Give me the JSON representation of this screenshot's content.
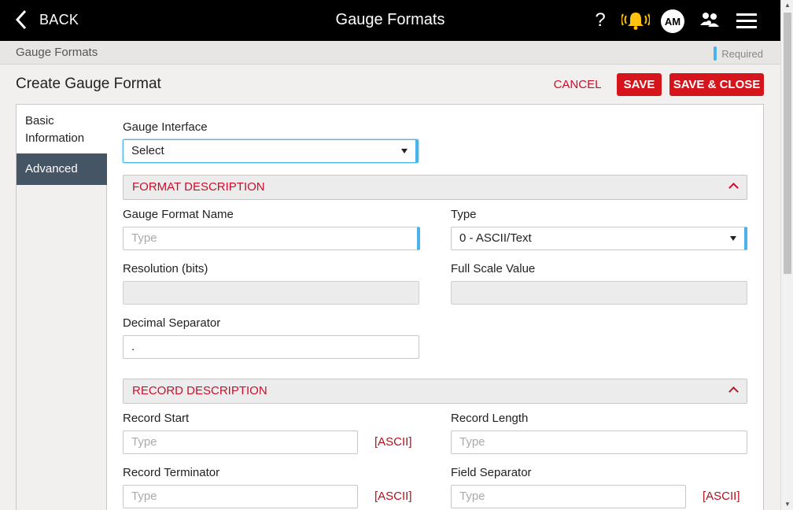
{
  "topbar": {
    "back_label": "BACK",
    "title": "Gauge Formats",
    "help_label": "?",
    "avatar_initials": "AM"
  },
  "breadcrumb": {
    "text": "Gauge Formats",
    "required_label": "Required"
  },
  "page": {
    "heading": "Create Gauge Format",
    "cancel_label": "CANCEL",
    "save_label": "SAVE",
    "save_close_label": "SAVE & CLOSE"
  },
  "sidebar": {
    "items": [
      {
        "label_line1": "Basic",
        "label_line2": "Information"
      },
      {
        "label": "Advanced"
      }
    ]
  },
  "form": {
    "gauge_interface": {
      "label": "Gauge Interface",
      "value": "Select"
    },
    "format_section": "FORMAT DESCRIPTION",
    "gauge_format_name": {
      "label": "Gauge Format Name",
      "placeholder": "Type"
    },
    "type": {
      "label": "Type",
      "value": "0 - ASCII/Text"
    },
    "resolution": {
      "label": "Resolution (bits)",
      "value": ""
    },
    "full_scale": {
      "label": "Full Scale Value",
      "value": ""
    },
    "decimal_separator": {
      "label": "Decimal Separator",
      "value": "."
    },
    "record_section": "RECORD DESCRIPTION",
    "record_start": {
      "label": "Record Start",
      "placeholder": "Type",
      "suffix": "[ASCII]"
    },
    "record_length": {
      "label": "Record Length",
      "placeholder": "Type"
    },
    "record_terminator": {
      "label": "Record Terminator",
      "placeholder": "Type",
      "suffix": "[ASCII]"
    },
    "field_separator": {
      "label": "Field Separator",
      "placeholder": "Type",
      "suffix": "[ASCII]"
    }
  },
  "colors": {
    "accent_red": "#d6141c",
    "required_blue": "#4ab3e8",
    "sidebar_active": "#465565"
  }
}
